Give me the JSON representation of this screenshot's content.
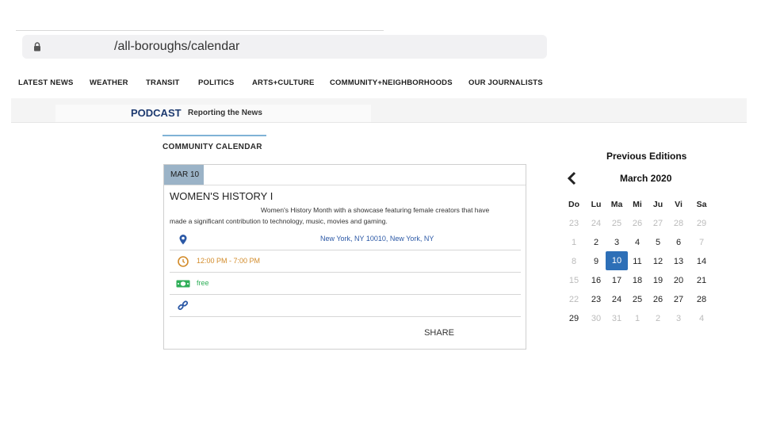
{
  "browser": {
    "url": "/all-boroughs/calendar"
  },
  "nav": {
    "items": [
      "LATEST NEWS",
      "WEATHER",
      "TRANSIT",
      "POLITICS",
      "ARTS+CULTURE",
      "COMMUNITY+NEIGHBORHOODS",
      "OUR JOURNALISTS"
    ]
  },
  "banner": {
    "podcast": "PODCAST",
    "podcast_sub": "Reporting the News"
  },
  "calendar_section": {
    "title": "COMMUNITY CALENDAR"
  },
  "event": {
    "date_badge": "MAR 10",
    "title": "WOMEN'S HISTORY I",
    "description_line1": "Women's History Month with a showcase featuring female creators that have",
    "description_line2": "made a significant contribution to technology, music, movies and gaming.",
    "location": "New York, NY 10010, New York, NY",
    "time": "12:00 PM - 7:00 PM",
    "price": "free",
    "share_label": "SHARE",
    "colors": {
      "location": "#2c59a6",
      "time": "#d28b2a",
      "price": "#2fae58"
    }
  },
  "editions": {
    "title": "Previous Editions",
    "month": "March 2020",
    "weekdays": [
      "Do",
      "Lu",
      "Ma",
      "Mi",
      "Ju",
      "Vi",
      "Sa"
    ],
    "weeks": [
      [
        {
          "d": "23",
          "o": true
        },
        {
          "d": "24",
          "o": true
        },
        {
          "d": "25",
          "o": true
        },
        {
          "d": "26",
          "o": true
        },
        {
          "d": "27",
          "o": true
        },
        {
          "d": "28",
          "o": true
        },
        {
          "d": "29",
          "o": true
        }
      ],
      [
        {
          "d": "1",
          "o": true
        },
        {
          "d": "2"
        },
        {
          "d": "3"
        },
        {
          "d": "4"
        },
        {
          "d": "5"
        },
        {
          "d": "6"
        },
        {
          "d": "7",
          "o": true
        }
      ],
      [
        {
          "d": "8",
          "o": true
        },
        {
          "d": "9"
        },
        {
          "d": "10",
          "s": true
        },
        {
          "d": "11"
        },
        {
          "d": "12"
        },
        {
          "d": "13"
        },
        {
          "d": "14"
        }
      ],
      [
        {
          "d": "15",
          "o": true
        },
        {
          "d": "16"
        },
        {
          "d": "17"
        },
        {
          "d": "18"
        },
        {
          "d": "19"
        },
        {
          "d": "20"
        },
        {
          "d": "21"
        }
      ],
      [
        {
          "d": "22",
          "o": true
        },
        {
          "d": "23"
        },
        {
          "d": "24"
        },
        {
          "d": "25"
        },
        {
          "d": "26"
        },
        {
          "d": "27"
        },
        {
          "d": "28"
        }
      ],
      [
        {
          "d": "29"
        },
        {
          "d": "30",
          "o": true
        },
        {
          "d": "31",
          "o": true
        },
        {
          "d": "1",
          "o": true
        },
        {
          "d": "2",
          "o": true
        },
        {
          "d": "3",
          "o": true
        },
        {
          "d": "4",
          "o": true
        }
      ]
    ],
    "selected_color": "#2d6fb7"
  }
}
